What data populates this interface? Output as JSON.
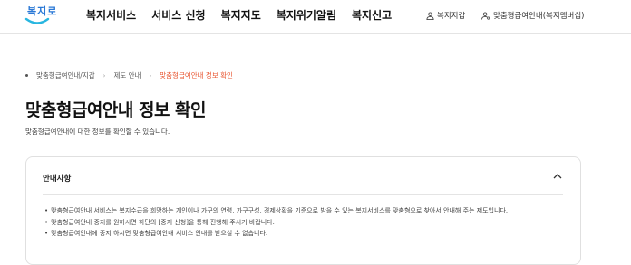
{
  "header": {
    "logo_text": "복지로",
    "nav": [
      "복지서비스",
      "서비스 신청",
      "복지지도",
      "복지위기알림",
      "복지신고"
    ],
    "utility": {
      "login": "복지지갑",
      "member": "맞춤형급여안내(복지멤버십)"
    }
  },
  "breadcrumb": {
    "items": [
      "맞춤형급여안내/지갑",
      "제도 안내",
      "맞춤형급여안내 정보 확인"
    ]
  },
  "page": {
    "title": "맞춤형급여안내 정보 확인",
    "description": "맞춤형급여안내에 대한 정보를 확인할 수 있습니다."
  },
  "notice": {
    "title": "안내사항",
    "items": [
      "맞춤형급여안내 서비스는 복지수급을 희망하는 개인이나 가구의 연령, 가구구성, 경제상황을 기준으로 받을 수 있는 복지서비스를 맞춤형으로 찾아서 안내해 주는 제도입니다.",
      "맞춤형급여안내 중지를 원하시면 하단의 [중지 신청]을 통해 진행해 주시기 바랍니다.",
      "맞춤형급여안내에 중지 하시면 맞춤형급여안내 서비스 안내를 받으실 수 없습니다."
    ]
  },
  "colors": {
    "accent": "#e8542f",
    "brand": "#2a78d6"
  }
}
